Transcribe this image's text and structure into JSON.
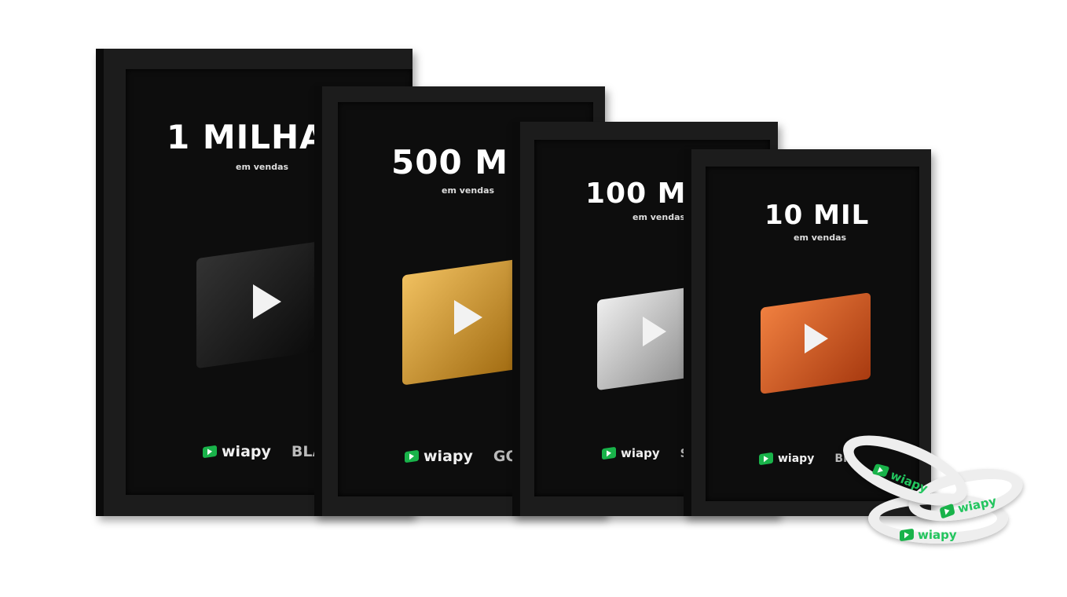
{
  "plaques": [
    {
      "title": "1 MILHA",
      "subtitle": "em vendas",
      "brand": "wiapy",
      "tier": "BLA",
      "color": "#2a2a2a"
    },
    {
      "title": "500 M",
      "subtitle": "em vendas",
      "brand": "wiapy",
      "tier": "GO",
      "color": "#d99a2b"
    },
    {
      "title": "100 M",
      "subtitle": "em vendas",
      "brand": "wiapy",
      "tier": "SI",
      "color": "#b8b8b8"
    },
    {
      "title": "10 MIL",
      "subtitle": "em vendas",
      "brand": "wiapy",
      "tier": "BR",
      "color": "#d0602a"
    }
  ],
  "wristbands": {
    "label": "wiapy",
    "text_color": "#22c55e"
  }
}
